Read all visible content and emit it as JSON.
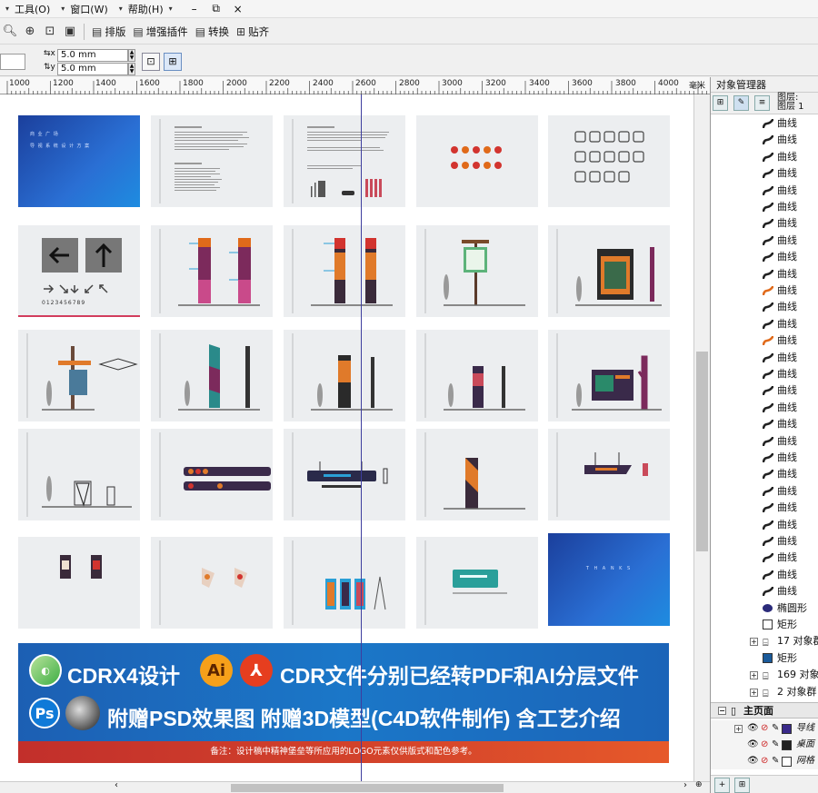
{
  "menubar": {
    "items": [
      "工具(O)",
      "窗口(W)",
      "帮助(H)"
    ],
    "window_buttons": [
      "–",
      "⧉",
      "×"
    ]
  },
  "toolbar": {
    "buttons": [
      "排版",
      "增强插件",
      "转换",
      "贴齐"
    ]
  },
  "propbar": {
    "x_offset": "5.0 mm",
    "y_offset": "5.0 mm"
  },
  "ruler": {
    "ticks": [
      "1000",
      "1200",
      "1400",
      "1600",
      "1800",
      "2000",
      "2200",
      "2400",
      "2600",
      "2800",
      "3000",
      "3200",
      "3400",
      "3600",
      "3800",
      "4000"
    ],
    "unit": "毫米"
  },
  "pages": {
    "cover_title_line1": "商 业 广 场",
    "cover_title_line2": "导 视 系 统 设 计 方 案",
    "digits_sample": "0123456789",
    "thanks_text": "T H A N K S"
  },
  "banner": {
    "line1_a": "CDRX4设计",
    "line1_b": "CDR文件分别已经转PDF和AI分层文件",
    "line2": "附赠PSD效果图 附赠3D模型(C4D软件制作) 含工艺介绍",
    "ai_logo": "Ai",
    "ps_logo": "Ps",
    "footnote": "备注：设计稿中精神堡垒等所应用的LOGO元素仅供版式和配色参考。"
  },
  "object_manager": {
    "title": "对象管理器",
    "layer_label_1": "图层:",
    "layer_label_2": "图层 1",
    "curve_label": "曲线",
    "ellipse_label": "椭圆形",
    "rect_label": "矩形",
    "group_17": "17 对象群",
    "group_169": "169 对象",
    "group_2": "2 对象群",
    "master_page": "主页面",
    "sub_1": "导线",
    "sub_2": "桌面",
    "sub_3": "网格"
  },
  "colors": {
    "accent_blue": "#1b6fc3",
    "banner_red": "#d5452b",
    "guide_line": "#3e3e9e",
    "curve_icon_black": "#222222",
    "curve_icon_orange": "#e06a1a"
  }
}
